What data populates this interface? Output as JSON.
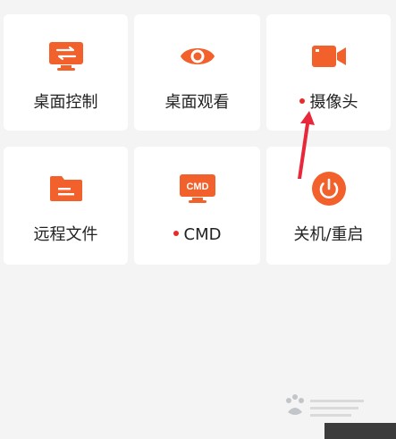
{
  "tiles": [
    {
      "label": "桌面控制",
      "icon": "desktop-transfer-icon",
      "dot": false
    },
    {
      "label": "桌面观看",
      "icon": "eye-icon",
      "dot": false
    },
    {
      "label": "摄像头",
      "icon": "video-camera-icon",
      "dot": true
    },
    {
      "label": "远程文件",
      "icon": "folder-icon",
      "dot": false
    },
    {
      "label": "CMD",
      "icon": "cmd-monitor-icon",
      "dot": true
    },
    {
      "label": "关机/重启",
      "icon": "power-icon",
      "dot": false
    }
  ],
  "icon_text": {
    "cmd": "CMD"
  },
  "colors": {
    "accent": "#f2602c",
    "dot": "#e82a2a",
    "tile_bg": "#ffffff",
    "page_bg": "#f4f4f4",
    "annotation": "#e8283a"
  }
}
